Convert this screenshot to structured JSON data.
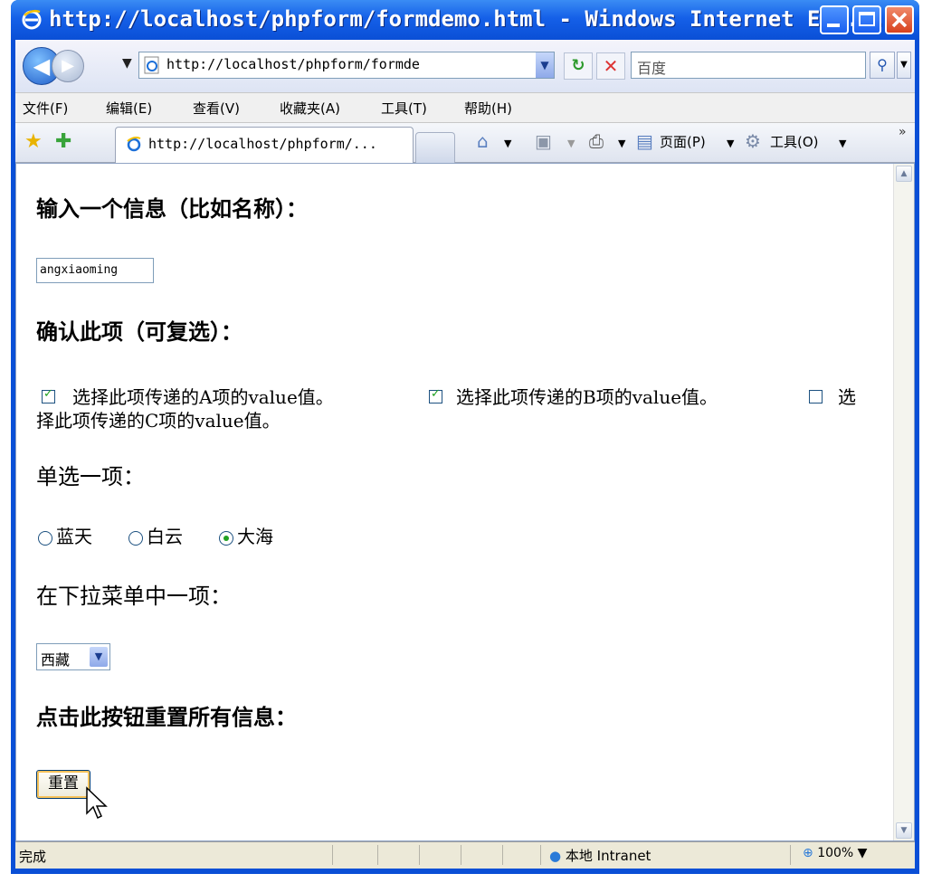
{
  "window": {
    "title": "http://localhost/phpform/formdemo.html - Windows Internet Exp..."
  },
  "addressbar": {
    "url": "http://localhost/phpform/formde",
    "search_value": "百度"
  },
  "menubar": {
    "items": [
      "文件(F)",
      "编辑(E)",
      "查看(V)",
      "收藏夹(A)",
      "工具(T)",
      "帮助(H)"
    ]
  },
  "tabbar": {
    "active_tab": "http://localhost/phpform/...",
    "page_menu": "页面(P)",
    "tools_menu": "工具(O)"
  },
  "form": {
    "heading_name": "输入一个信息（比如名称）：",
    "name_value": "angxiaoming",
    "heading_confirm": "确认此项（可复选）：",
    "checkboxes": [
      {
        "label": "选择此项传递的A项的value值。",
        "checked": true
      },
      {
        "label": "选择此项传递的B项的value值。",
        "checked": true
      },
      {
        "label_part1": "选",
        "label_part2": "择此项传递的C项的value值。",
        "checked": false
      }
    ],
    "heading_radio": "单选一项：",
    "radios": [
      {
        "label": "蓝天",
        "checked": false
      },
      {
        "label": "白云",
        "checked": false
      },
      {
        "label": "大海",
        "checked": true
      }
    ],
    "heading_select": "在下拉菜单中一项：",
    "select_value": "西藏",
    "heading_reset": "点击此按钮重置所有信息：",
    "reset_label": "重置"
  },
  "statusbar": {
    "status": "完成",
    "zone": "本地 Intranet",
    "zoom": "100%"
  },
  "colors": {
    "title_bar": "#0a4fd6",
    "check_mark": "#21a121"
  }
}
